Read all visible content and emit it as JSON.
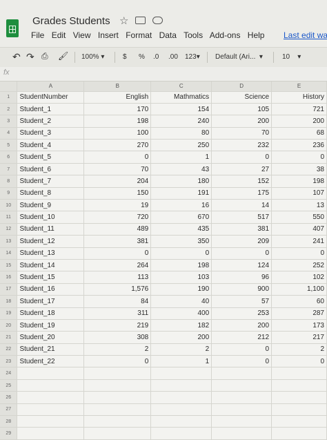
{
  "doc": {
    "title": "Grades Students",
    "menu": [
      "File",
      "Edit",
      "View",
      "Insert",
      "Format",
      "Data",
      "Tools",
      "Add-ons",
      "Help"
    ],
    "last_edit": "Last edit wa"
  },
  "toolbar": {
    "zoom": "100%",
    "currency": "$",
    "percent": "%",
    "decrease_decimals": ".0",
    "increase_decimals": ".00",
    "more_formats": "123",
    "font": "Default (Ari...",
    "font_size": "10"
  },
  "formula_bar": {
    "fx": "fx",
    "value": ""
  },
  "sheet": {
    "columns": [
      "A",
      "B",
      "C",
      "D",
      "E"
    ],
    "rows": [
      [
        "StudentNumber",
        "English",
        "Mathmatics",
        "Science",
        "History"
      ],
      [
        "Student_1",
        "170",
        "154",
        "105",
        "721"
      ],
      [
        "Student_2",
        "198",
        "240",
        "200",
        "200"
      ],
      [
        "Student_3",
        "100",
        "80",
        "70",
        "68"
      ],
      [
        "Student_4",
        "270",
        "250",
        "232",
        "236"
      ],
      [
        "Student_5",
        "0",
        "1",
        "0",
        "0"
      ],
      [
        "Student_6",
        "70",
        "43",
        "27",
        "38"
      ],
      [
        "Student_7",
        "204",
        "180",
        "152",
        "198"
      ],
      [
        "Student_8",
        "150",
        "191",
        "175",
        "107"
      ],
      [
        "Student_9",
        "19",
        "16",
        "14",
        "13"
      ],
      [
        "Student_10",
        "720",
        "670",
        "517",
        "550"
      ],
      [
        "Student_11",
        "489",
        "435",
        "381",
        "407"
      ],
      [
        "Student_12",
        "381",
        "350",
        "209",
        "241"
      ],
      [
        "Student_13",
        "0",
        "0",
        "0",
        "0"
      ],
      [
        "Student_14",
        "264",
        "198",
        "124",
        "252"
      ],
      [
        "Student_15",
        "113",
        "103",
        "96",
        "102"
      ],
      [
        "Student_16",
        "1,576",
        "190",
        "900",
        "1,100"
      ],
      [
        "Student_17",
        "84",
        "40",
        "57",
        "60"
      ],
      [
        "Student_18",
        "311",
        "400",
        "253",
        "287"
      ],
      [
        "Student_19",
        "219",
        "182",
        "200",
        "173"
      ],
      [
        "Student_20",
        "308",
        "200",
        "212",
        "217"
      ],
      [
        "Student_21",
        "2",
        "2",
        "0",
        "2"
      ],
      [
        "Student_22",
        "0",
        "1",
        "0",
        "0"
      ],
      [
        "",
        "",
        "",
        "",
        ""
      ],
      [
        "",
        "",
        "",
        "",
        ""
      ],
      [
        "",
        "",
        "",
        "",
        ""
      ],
      [
        "",
        "",
        "",
        "",
        ""
      ],
      [
        "",
        "",
        "",
        "",
        ""
      ],
      [
        "",
        "",
        "",
        "",
        ""
      ]
    ]
  }
}
